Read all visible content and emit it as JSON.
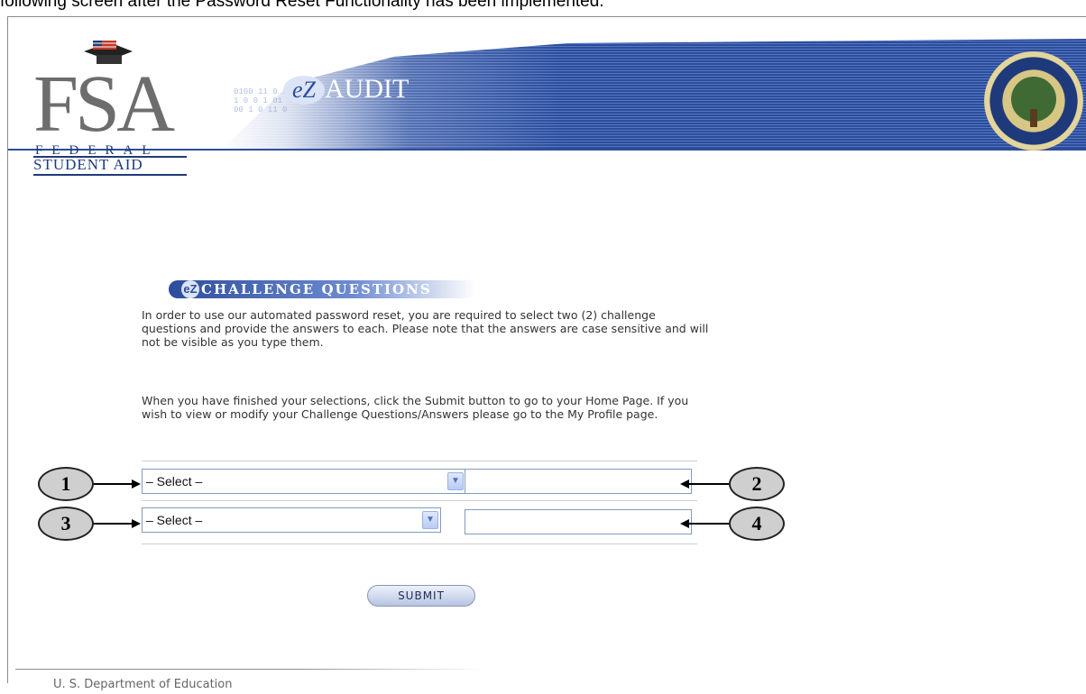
{
  "top_caption": "following screen after the Password Reset Functionality has been implemented.",
  "header": {
    "logo_letters": "FSA",
    "logo_federal": "FEDERAL",
    "logo_student_aid": "STUDENT AID",
    "app_title_mark": "eZ",
    "app_title": "AUDIT",
    "seal_name": "department-of-education-seal-icon"
  },
  "section": {
    "title": "CHALLENGE QUESTIONS",
    "icon_glyph": "eZ",
    "paragraph1": "In order to use our automated password reset, you are required to select two (2) challenge questions and provide the answers to each. Please note that the answers are case sensitive and will not be visible as you type them.",
    "paragraph2": "When you have finished your selections, click the Submit button to go to your Home Page. If you wish to view or modify your Challenge Questions/Answers please go to the My Profile page."
  },
  "questions": [
    {
      "select_value": "– Select –",
      "answer_value": "",
      "callout_select": "1",
      "callout_answer": "2"
    },
    {
      "select_value": "– Select –",
      "answer_value": "",
      "callout_select": "3",
      "callout_answer": "4"
    }
  ],
  "submit_label": "SUBMIT",
  "footer": "U. S. Department of Education",
  "colors": {
    "banner": "#2c4d9b",
    "field_border": "#7f9db9",
    "callout_fill": "#cfcfcf"
  }
}
